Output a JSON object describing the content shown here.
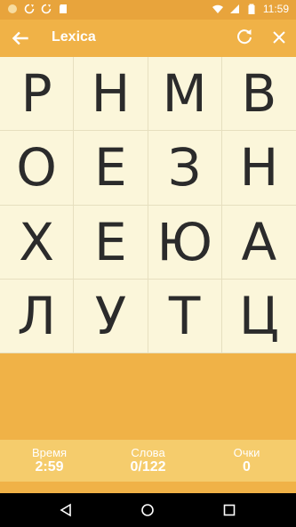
{
  "status_bar": {
    "time": "11:59",
    "icons": [
      "circle-icon",
      "sync-icon",
      "sync-icon",
      "sd-card-icon",
      "wifi-icon",
      "cellular-icon",
      "battery-icon"
    ]
  },
  "app_bar": {
    "title": "Lexica",
    "icons": [
      "back-arrow-icon",
      "refresh-icon",
      "close-icon"
    ]
  },
  "board": {
    "rows": [
      [
        "Р",
        "Н",
        "М",
        "В"
      ],
      [
        "О",
        "Е",
        "З",
        "Н"
      ],
      [
        "Х",
        "Е",
        "Ю",
        "А"
      ],
      [
        "Л",
        "У",
        "Т",
        "Ц"
      ]
    ]
  },
  "stats": {
    "time_label": "Время",
    "time_value": "2:59",
    "words_label": "Слова",
    "words_value": "0/122",
    "score_label": "Очки",
    "score_value": "0"
  },
  "colors": {
    "status_bar": "#e8a43c",
    "accent": "#f0b247",
    "board_bg": "#fbf6da",
    "stats_bg": "#f5cc6c",
    "letter": "#2b2b2b"
  },
  "nav_bar": {
    "icons": [
      "nav-back-icon",
      "nav-home-icon",
      "nav-recent-icon"
    ]
  }
}
